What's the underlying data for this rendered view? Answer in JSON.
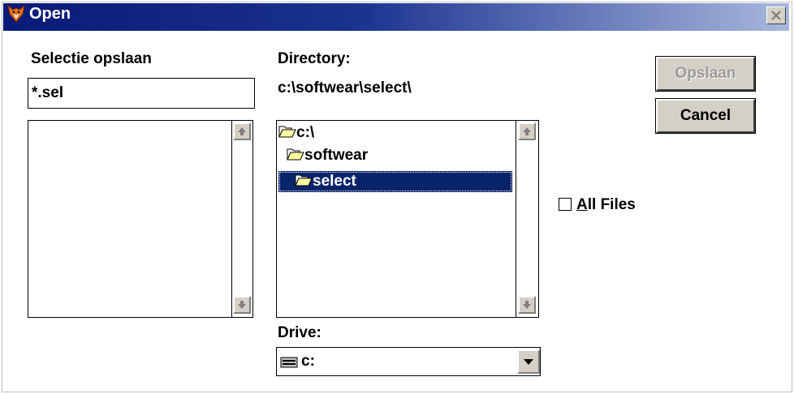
{
  "window": {
    "title": "Open",
    "close_glyph": "✕"
  },
  "save_selection": {
    "label": "Selectie opslaan",
    "filename_value": "*.sel",
    "files": []
  },
  "directory": {
    "label": "Directory:",
    "current_path": "c:\\softwear\\select\\",
    "items": [
      {
        "label": "c:\\",
        "icon": "open-folder-icon",
        "selected": false
      },
      {
        "label": "softwear",
        "icon": "open-folder-icon",
        "selected": false
      },
      {
        "label": "select",
        "icon": "open-folder-icon",
        "selected": true
      }
    ]
  },
  "drive": {
    "label": "Drive:",
    "value": "c:",
    "icon": "drive-icon"
  },
  "buttons": {
    "save_label": "Opslaan",
    "cancel_label": "Cancel"
  },
  "all_files": {
    "label_prefix": "",
    "mnemonic": "A",
    "label_rest": "ll Files",
    "checked": false
  },
  "scroll_arrows": {
    "up": "⇧",
    "down": "⇩",
    "dropdown": "▼"
  },
  "colors": {
    "titlebar_start": "#0a1a78",
    "titlebar_end": "#a8b8dc",
    "selection": "#0a246a",
    "button_face": "#d4d0c8"
  }
}
